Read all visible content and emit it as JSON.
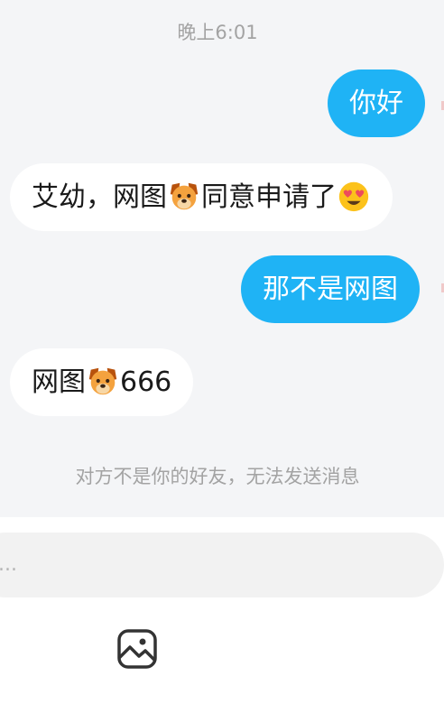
{
  "header": {
    "timestamp": "晚上6:01"
  },
  "messages": [
    {
      "direction": "sent",
      "text": "你好"
    },
    {
      "direction": "received",
      "text_before": "艾幼，网图",
      "emoji_1": "dog-face-emoji",
      "text_after": "同意申请了",
      "emoji_2": "heart-eyes-emoji"
    },
    {
      "direction": "sent",
      "text": "那不是网图"
    },
    {
      "direction": "received",
      "text_before": "网图",
      "emoji_1": "dog-face-emoji",
      "text_after": "666"
    }
  ],
  "notice": "对方不是你的好友，无法发送消息",
  "composer": {
    "placeholder": "..."
  },
  "toolbar": {
    "image_icon": "image-icon"
  },
  "colors": {
    "sent_bubble": "#1fb3f5",
    "received_bubble": "#ffffff",
    "background": "#f4f5f7",
    "muted_text": "#a3a3a3"
  }
}
